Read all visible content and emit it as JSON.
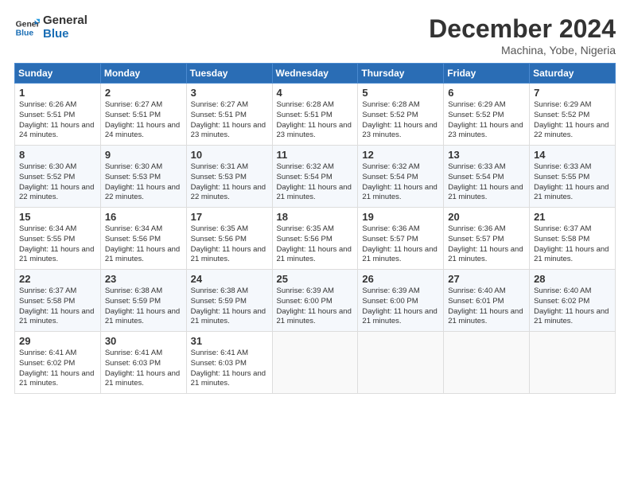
{
  "header": {
    "logo_line1": "General",
    "logo_line2": "Blue",
    "month_title": "December 2024",
    "location": "Machina, Yobe, Nigeria"
  },
  "days_of_week": [
    "Sunday",
    "Monday",
    "Tuesday",
    "Wednesday",
    "Thursday",
    "Friday",
    "Saturday"
  ],
  "weeks": [
    [
      {
        "day": "1",
        "sunrise": "6:26 AM",
        "sunset": "5:51 PM",
        "daylight": "11 hours and 24 minutes."
      },
      {
        "day": "2",
        "sunrise": "6:27 AM",
        "sunset": "5:51 PM",
        "daylight": "11 hours and 24 minutes."
      },
      {
        "day": "3",
        "sunrise": "6:27 AM",
        "sunset": "5:51 PM",
        "daylight": "11 hours and 23 minutes."
      },
      {
        "day": "4",
        "sunrise": "6:28 AM",
        "sunset": "5:51 PM",
        "daylight": "11 hours and 23 minutes."
      },
      {
        "day": "5",
        "sunrise": "6:28 AM",
        "sunset": "5:52 PM",
        "daylight": "11 hours and 23 minutes."
      },
      {
        "day": "6",
        "sunrise": "6:29 AM",
        "sunset": "5:52 PM",
        "daylight": "11 hours and 23 minutes."
      },
      {
        "day": "7",
        "sunrise": "6:29 AM",
        "sunset": "5:52 PM",
        "daylight": "11 hours and 22 minutes."
      }
    ],
    [
      {
        "day": "8",
        "sunrise": "6:30 AM",
        "sunset": "5:52 PM",
        "daylight": "11 hours and 22 minutes."
      },
      {
        "day": "9",
        "sunrise": "6:30 AM",
        "sunset": "5:53 PM",
        "daylight": "11 hours and 22 minutes."
      },
      {
        "day": "10",
        "sunrise": "6:31 AM",
        "sunset": "5:53 PM",
        "daylight": "11 hours and 22 minutes."
      },
      {
        "day": "11",
        "sunrise": "6:32 AM",
        "sunset": "5:54 PM",
        "daylight": "11 hours and 21 minutes."
      },
      {
        "day": "12",
        "sunrise": "6:32 AM",
        "sunset": "5:54 PM",
        "daylight": "11 hours and 21 minutes."
      },
      {
        "day": "13",
        "sunrise": "6:33 AM",
        "sunset": "5:54 PM",
        "daylight": "11 hours and 21 minutes."
      },
      {
        "day": "14",
        "sunrise": "6:33 AM",
        "sunset": "5:55 PM",
        "daylight": "11 hours and 21 minutes."
      }
    ],
    [
      {
        "day": "15",
        "sunrise": "6:34 AM",
        "sunset": "5:55 PM",
        "daylight": "11 hours and 21 minutes."
      },
      {
        "day": "16",
        "sunrise": "6:34 AM",
        "sunset": "5:56 PM",
        "daylight": "11 hours and 21 minutes."
      },
      {
        "day": "17",
        "sunrise": "6:35 AM",
        "sunset": "5:56 PM",
        "daylight": "11 hours and 21 minutes."
      },
      {
        "day": "18",
        "sunrise": "6:35 AM",
        "sunset": "5:56 PM",
        "daylight": "11 hours and 21 minutes."
      },
      {
        "day": "19",
        "sunrise": "6:36 AM",
        "sunset": "5:57 PM",
        "daylight": "11 hours and 21 minutes."
      },
      {
        "day": "20",
        "sunrise": "6:36 AM",
        "sunset": "5:57 PM",
        "daylight": "11 hours and 21 minutes."
      },
      {
        "day": "21",
        "sunrise": "6:37 AM",
        "sunset": "5:58 PM",
        "daylight": "11 hours and 21 minutes."
      }
    ],
    [
      {
        "day": "22",
        "sunrise": "6:37 AM",
        "sunset": "5:58 PM",
        "daylight": "11 hours and 21 minutes."
      },
      {
        "day": "23",
        "sunrise": "6:38 AM",
        "sunset": "5:59 PM",
        "daylight": "11 hours and 21 minutes."
      },
      {
        "day": "24",
        "sunrise": "6:38 AM",
        "sunset": "5:59 PM",
        "daylight": "11 hours and 21 minutes."
      },
      {
        "day": "25",
        "sunrise": "6:39 AM",
        "sunset": "6:00 PM",
        "daylight": "11 hours and 21 minutes."
      },
      {
        "day": "26",
        "sunrise": "6:39 AM",
        "sunset": "6:00 PM",
        "daylight": "11 hours and 21 minutes."
      },
      {
        "day": "27",
        "sunrise": "6:40 AM",
        "sunset": "6:01 PM",
        "daylight": "11 hours and 21 minutes."
      },
      {
        "day": "28",
        "sunrise": "6:40 AM",
        "sunset": "6:02 PM",
        "daylight": "11 hours and 21 minutes."
      }
    ],
    [
      {
        "day": "29",
        "sunrise": "6:41 AM",
        "sunset": "6:02 PM",
        "daylight": "11 hours and 21 minutes."
      },
      {
        "day": "30",
        "sunrise": "6:41 AM",
        "sunset": "6:03 PM",
        "daylight": "11 hours and 21 minutes."
      },
      {
        "day": "31",
        "sunrise": "6:41 AM",
        "sunset": "6:03 PM",
        "daylight": "11 hours and 21 minutes."
      },
      null,
      null,
      null,
      null
    ]
  ]
}
